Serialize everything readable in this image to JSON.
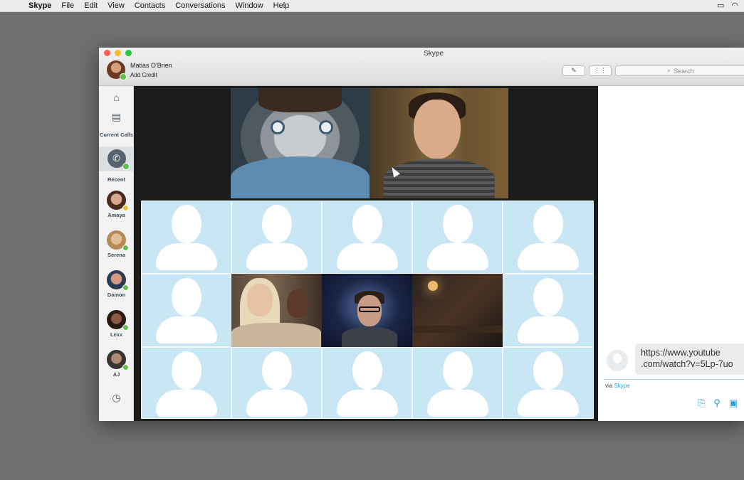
{
  "menubar": {
    "app_name": "Skype",
    "items": [
      "File",
      "Edit",
      "View",
      "Contacts",
      "Conversations",
      "Window",
      "Help"
    ]
  },
  "window": {
    "title": "Skype"
  },
  "profile": {
    "name": "Matias O'Brien",
    "sub": "Add Credit"
  },
  "toolbar": {
    "search_placeholder": "Search"
  },
  "sidebar": {
    "current_calls": "Current Calls",
    "recent": "Recent",
    "contacts": [
      {
        "name": "Amaya",
        "status": "away"
      },
      {
        "name": "Serena",
        "status": "online"
      },
      {
        "name": "Damon",
        "status": "online"
      },
      {
        "name": "Lexx",
        "status": "online"
      },
      {
        "name": "AJ",
        "status": "online"
      }
    ]
  },
  "chat": {
    "message": "https://www.youtube .com/watch?v=5Lp-7uo",
    "via_prefix": "via",
    "via_link": "Skype"
  },
  "colors": {
    "accent": "#1ea0da",
    "online": "#5fc14a",
    "away": "#e9c22b",
    "placeholder_tile": "#c9e6f5"
  }
}
